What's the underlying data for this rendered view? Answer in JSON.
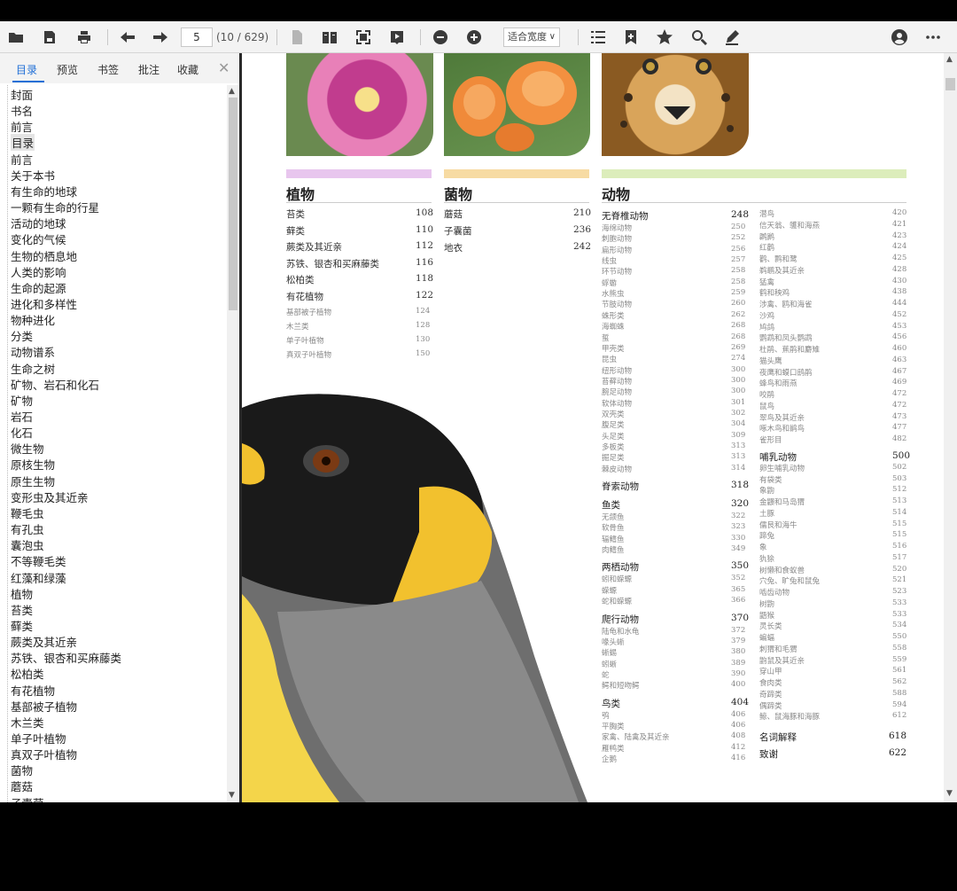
{
  "toolbar": {
    "page_input": "5",
    "page_count": "(10 / 629)",
    "zoom": "适合宽度",
    "icons_left": [
      "open-folder-icon",
      "save-icon",
      "print-icon",
      "back-arrow-icon",
      "forward-arrow-icon"
    ],
    "icons_mid": [
      "page-icon",
      "two-page-icon",
      "fullscreen-icon",
      "presentation-icon",
      "zoom-out-icon",
      "zoom-in-icon"
    ],
    "icons_right": [
      "toc-list-icon",
      "bookmark-icon",
      "star-icon",
      "search-icon",
      "annotate-pen-icon",
      "account-icon",
      "more-icon"
    ]
  },
  "sidebar": {
    "tabs": [
      "目录",
      "预览",
      "书签",
      "批注",
      "收藏"
    ],
    "active_tab": "目录",
    "close": "✕",
    "toc": [
      "封面",
      "书名",
      "前言",
      "目录",
      "前言",
      "关于本书",
      "有生命的地球",
      "一颗有生命的行星",
      "活动的地球",
      "变化的气候",
      "生物的栖息地",
      "人类的影响",
      "生命的起源",
      "进化和多样性",
      "物种进化",
      "分类",
      "动物谱系",
      "生命之树",
      "矿物、岩石和化石",
      "矿物",
      "岩石",
      "化石",
      "微生物",
      "原核生物",
      "原生生物",
      "变形虫及其近亲",
      "鞭毛虫",
      "有孔虫",
      "囊泡虫",
      "不等鞭毛类",
      "红藻和绿藻",
      "植物",
      "苔类",
      "藓类",
      "蕨类及其近亲",
      "苏铁、银杏和买麻藤类",
      "松柏类",
      "有花植物",
      "基部被子植物",
      "木兰类",
      "单子叶植物",
      "真双子叶植物",
      "菌物",
      "蘑菇",
      "子囊菌"
    ],
    "selected_index": 3
  },
  "page": {
    "plants": {
      "title": "植物",
      "color": "#e8c6ee",
      "entries": [
        {
          "t": "苔类",
          "p": "108",
          "k": "maj"
        },
        {
          "t": "藓类",
          "p": "110",
          "k": "maj"
        },
        {
          "t": "蕨类及其近亲",
          "p": "112",
          "k": "maj"
        },
        {
          "t": "苏铁、银杏和买麻藤类",
          "p": "116",
          "k": "maj"
        },
        {
          "t": "松柏类",
          "p": "118",
          "k": "maj"
        },
        {
          "t": "有花植物",
          "p": "122",
          "k": "maj"
        },
        {
          "t": "基部被子植物",
          "p": "124",
          "k": "sub"
        },
        {
          "t": "木兰类",
          "p": "128",
          "k": "sub"
        },
        {
          "t": "单子叶植物",
          "p": "130",
          "k": "sub"
        },
        {
          "t": "真双子叶植物",
          "p": "150",
          "k": "sub"
        }
      ]
    },
    "fungi": {
      "title": "菌物",
      "color": "#f7dba3",
      "entries": [
        {
          "t": "蘑菇",
          "p": "210",
          "k": "maj"
        },
        {
          "t": "子囊菌",
          "p": "236",
          "k": "maj"
        },
        {
          "t": "地衣",
          "p": "242",
          "k": "maj"
        }
      ]
    },
    "animals": {
      "title": "动物",
      "color": "#dcedbb",
      "col1": [
        {
          "t": "无脊椎动物",
          "p": "248",
          "k": "grp"
        },
        {
          "t": "海绵动物",
          "p": "250",
          "k": "sub"
        },
        {
          "t": "刺胞动物",
          "p": "252",
          "k": "sub"
        },
        {
          "t": "扁形动物",
          "p": "256",
          "k": "sub"
        },
        {
          "t": "线虫",
          "p": "257",
          "k": "sub"
        },
        {
          "t": "环节动物",
          "p": "258",
          "k": "sub"
        },
        {
          "t": "蜉蝣",
          "p": "258",
          "k": "sub"
        },
        {
          "t": "水熊虫",
          "p": "259",
          "k": "sub"
        },
        {
          "t": "节肢动物",
          "p": "260",
          "k": "sub"
        },
        {
          "t": "蛛形类",
          "p": "262",
          "k": "sub"
        },
        {
          "t": "海蜘蛛",
          "p": "268",
          "k": "sub"
        },
        {
          "t": "蜇",
          "p": "268",
          "k": "sub"
        },
        {
          "t": "甲壳类",
          "p": "269",
          "k": "sub"
        },
        {
          "t": "昆虫",
          "p": "274",
          "k": "sub"
        },
        {
          "t": "纽形动物",
          "p": "300",
          "k": "sub"
        },
        {
          "t": "苔藓动物",
          "p": "300",
          "k": "sub"
        },
        {
          "t": "腕足动物",
          "p": "300",
          "k": "sub"
        },
        {
          "t": "软体动物",
          "p": "301",
          "k": "sub"
        },
        {
          "t": "双壳类",
          "p": "302",
          "k": "sub"
        },
        {
          "t": "腹足类",
          "p": "304",
          "k": "sub"
        },
        {
          "t": "头足类",
          "p": "309",
          "k": "sub"
        },
        {
          "t": "多板类",
          "p": "313",
          "k": "sub"
        },
        {
          "t": "掘足类",
          "p": "313",
          "k": "sub"
        },
        {
          "t": "棘皮动物",
          "p": "314",
          "k": "sub"
        },
        {
          "t": "脊索动物",
          "p": "318",
          "k": "grp"
        },
        {
          "t": "鱼类",
          "p": "320",
          "k": "grp"
        },
        {
          "t": "无颌鱼",
          "p": "322",
          "k": "sub"
        },
        {
          "t": "软骨鱼",
          "p": "323",
          "k": "sub"
        },
        {
          "t": "辐鳍鱼",
          "p": "330",
          "k": "sub"
        },
        {
          "t": "肉鳍鱼",
          "p": "349",
          "k": "sub"
        },
        {
          "t": "两栖动物",
          "p": "350",
          "k": "grp"
        },
        {
          "t": "蚓和蝾螈",
          "p": "352",
          "k": "sub"
        },
        {
          "t": "蝾螈",
          "p": "365",
          "k": "sub"
        },
        {
          "t": "蛇和蝾螈",
          "p": "366",
          "k": "sub"
        },
        {
          "t": "爬行动物",
          "p": "370",
          "k": "grp"
        },
        {
          "t": "陆龟和水龟",
          "p": "372",
          "k": "sub"
        },
        {
          "t": "喙头蜥",
          "p": "379",
          "k": "sub"
        },
        {
          "t": "蜥蜴",
          "p": "380",
          "k": "sub"
        },
        {
          "t": "蚓蜥",
          "p": "389",
          "k": "sub"
        },
        {
          "t": "蛇",
          "p": "390",
          "k": "sub"
        },
        {
          "t": "鳄和短吻鳄",
          "p": "400",
          "k": "sub"
        },
        {
          "t": "鸟类",
          "p": "404",
          "k": "grp"
        },
        {
          "t": "鸮",
          "p": "406",
          "k": "sub"
        },
        {
          "t": "平胸类",
          "p": "406",
          "k": "sub"
        },
        {
          "t": "家禽、陆禽及其近亲",
          "p": "408",
          "k": "sub"
        },
        {
          "t": "雁鸭类",
          "p": "412",
          "k": "sub"
        },
        {
          "t": "企鹅",
          "p": "416",
          "k": "sub"
        }
      ],
      "col2": [
        {
          "t": "潜鸟",
          "p": "420",
          "k": "sub"
        },
        {
          "t": "信天翁、鹱和海燕",
          "p": "421",
          "k": "sub"
        },
        {
          "t": "䴙䴘",
          "p": "423",
          "k": "sub"
        },
        {
          "t": "红鹳",
          "p": "424",
          "k": "sub"
        },
        {
          "t": "鹳、鹮和鹭",
          "p": "425",
          "k": "sub"
        },
        {
          "t": "鹈鹕及其近亲",
          "p": "428",
          "k": "sub"
        },
        {
          "t": "猛禽",
          "p": "430",
          "k": "sub"
        },
        {
          "t": "鹤和秧鸡",
          "p": "438",
          "k": "sub"
        },
        {
          "t": "涉禽、鸥和海雀",
          "p": "444",
          "k": "sub"
        },
        {
          "t": "沙鸡",
          "p": "452",
          "k": "sub"
        },
        {
          "t": "鸠鸽",
          "p": "453",
          "k": "sub"
        },
        {
          "t": "鹦鹉和凤头鹦鹉",
          "p": "456",
          "k": "sub"
        },
        {
          "t": "杜鹃、蕉鹃和麝雉",
          "p": "460",
          "k": "sub"
        },
        {
          "t": "猫头鹰",
          "p": "463",
          "k": "sub"
        },
        {
          "t": "夜鹰和蟆口鸱鹃",
          "p": "467",
          "k": "sub"
        },
        {
          "t": "蜂鸟和雨燕",
          "p": "469",
          "k": "sub"
        },
        {
          "t": "咬鹃",
          "p": "472",
          "k": "sub"
        },
        {
          "t": "鼠鸟",
          "p": "472",
          "k": "sub"
        },
        {
          "t": "翠鸟及其近亲",
          "p": "473",
          "k": "sub"
        },
        {
          "t": "啄木鸟和鹟鸟",
          "p": "477",
          "k": "sub"
        },
        {
          "t": "雀形目",
          "p": "482",
          "k": "sub"
        },
        {
          "t": "哺乳动物",
          "p": "500",
          "k": "grp"
        },
        {
          "t": "卵生哺乳动物",
          "p": "502",
          "k": "sub"
        },
        {
          "t": "有袋类",
          "p": "503",
          "k": "sub"
        },
        {
          "t": "象鼩",
          "p": "512",
          "k": "sub"
        },
        {
          "t": "金鼹和马岛猬",
          "p": "513",
          "k": "sub"
        },
        {
          "t": "土豚",
          "p": "514",
          "k": "sub"
        },
        {
          "t": "儒艮和海牛",
          "p": "515",
          "k": "sub"
        },
        {
          "t": "蹄兔",
          "p": "515",
          "k": "sub"
        },
        {
          "t": "象",
          "p": "516",
          "k": "sub"
        },
        {
          "t": "犰狳",
          "p": "517",
          "k": "sub"
        },
        {
          "t": "树懒和食蚁兽",
          "p": "520",
          "k": "sub"
        },
        {
          "t": "穴兔、旷兔和鼠兔",
          "p": "521",
          "k": "sub"
        },
        {
          "t": "啮齿动物",
          "p": "523",
          "k": "sub"
        },
        {
          "t": "树鼩",
          "p": "533",
          "k": "sub"
        },
        {
          "t": "鼯猴",
          "p": "533",
          "k": "sub"
        },
        {
          "t": "灵长类",
          "p": "534",
          "k": "sub"
        },
        {
          "t": "蝙蝠",
          "p": "550",
          "k": "sub"
        },
        {
          "t": "刺猬和毛猬",
          "p": "558",
          "k": "sub"
        },
        {
          "t": "鼩鼠及其近亲",
          "p": "559",
          "k": "sub"
        },
        {
          "t": "穿山甲",
          "p": "561",
          "k": "sub"
        },
        {
          "t": "食肉类",
          "p": "562",
          "k": "sub"
        },
        {
          "t": "奇蹄类",
          "p": "588",
          "k": "sub"
        },
        {
          "t": "偶蹄类",
          "p": "594",
          "k": "sub"
        },
        {
          "t": "鲸、鼠海豚和海豚",
          "p": "612",
          "k": "sub"
        }
      ],
      "extra": [
        {
          "t": "名词解释",
          "p": "618"
        },
        {
          "t": "致谢",
          "p": "622"
        }
      ]
    }
  }
}
